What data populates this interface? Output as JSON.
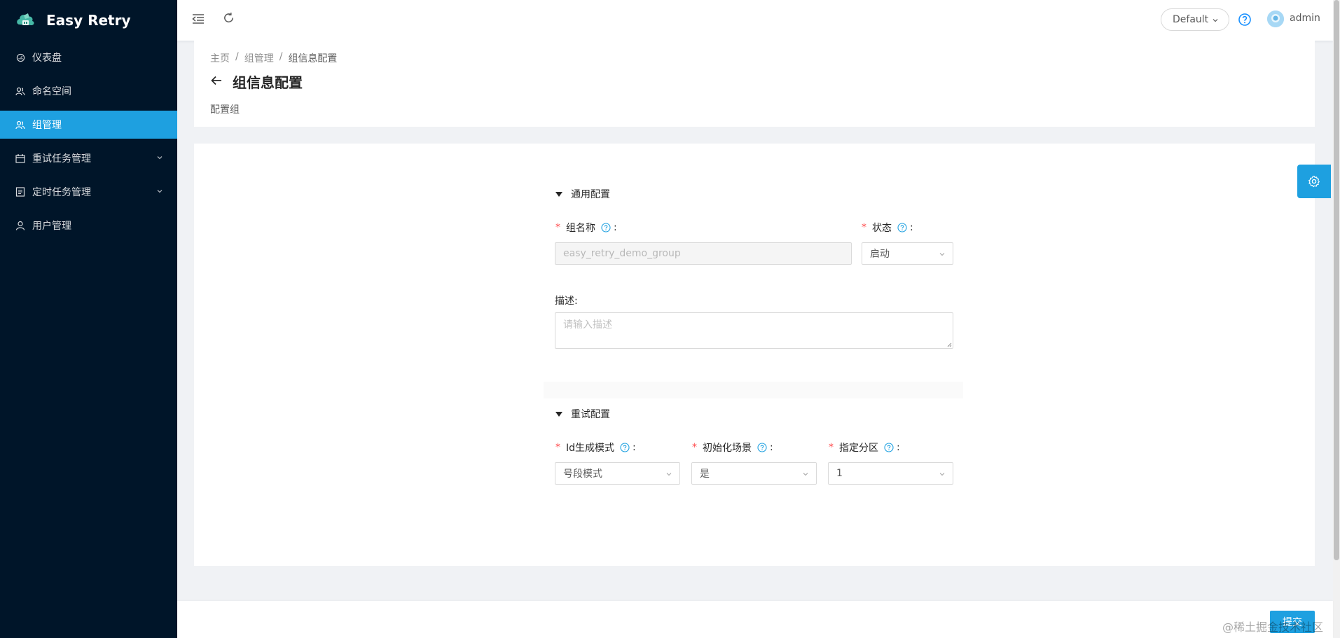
{
  "app": {
    "name": "Easy Retry"
  },
  "sidebar": {
    "items": [
      {
        "label": "仪表盘",
        "icon": "dashboard-icon"
      },
      {
        "label": "命名空间",
        "icon": "team-icon"
      },
      {
        "label": "组管理",
        "icon": "team-icon",
        "active": true
      },
      {
        "label": "重试任务管理",
        "icon": "calendar-icon",
        "expandable": true
      },
      {
        "label": "定时任务管理",
        "icon": "profile-icon",
        "expandable": true
      },
      {
        "label": "用户管理",
        "icon": "user-icon"
      }
    ]
  },
  "header": {
    "namespace_select": "Default",
    "username": "admin"
  },
  "breadcrumb": {
    "items": [
      "主页",
      "组管理",
      "组信息配置"
    ]
  },
  "page": {
    "title": "组信息配置",
    "subtitle": "配置组"
  },
  "form": {
    "general_section": "通用配置",
    "group_name_label": "组名称",
    "group_name_value": "easy_retry_demo_group",
    "status_label": "状态",
    "status_value": "启动",
    "description_label": "描述:",
    "description_placeholder": "请输入描述",
    "retry_section": "重试配置",
    "id_mode_label": "Id生成模式",
    "id_mode_value": "号段模式",
    "init_scene_label": "初始化场景",
    "init_scene_value": "是",
    "partition_label": "指定分区",
    "partition_value": "1",
    "colon": ":"
  },
  "footer": {
    "submit_label": "提交",
    "watermark": "@稀土掘金技术社区"
  },
  "colors": {
    "sidebar_bg": "#001529",
    "accent": "#1ea0e0",
    "required": "#ff4d4f"
  }
}
